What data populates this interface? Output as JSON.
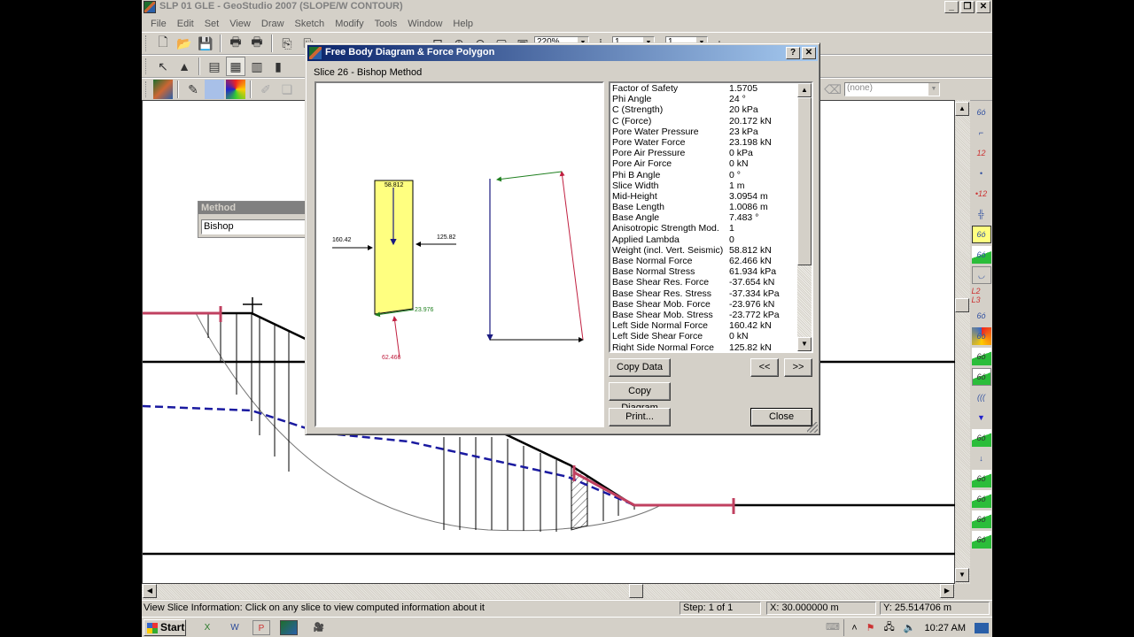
{
  "app": {
    "title": "SLP 01 GLE - GeoStudio 2007 (SLOPE/W CONTOUR)",
    "window_buttons": [
      "minimize",
      "restore",
      "close"
    ]
  },
  "menu": [
    "File",
    "Edit",
    "Set",
    "View",
    "Draw",
    "Sketch",
    "Modify",
    "Tools",
    "Window",
    "Help"
  ],
  "toolbar": {
    "zoom_value": "220%",
    "x_select": "1",
    "y_select": "1",
    "layer_select": "(none)"
  },
  "method_panel": {
    "title": "Method",
    "selected": "Bishop"
  },
  "dialog": {
    "title": "Free Body Diagram & Force Polygon",
    "help_button": "?",
    "close_button": "✕",
    "subtitle": "Slice 26 - Bishop Method",
    "diagram": {
      "weight_label": "58.812",
      "left_force_label": "160.42",
      "right_force_label": "125.82",
      "shear_label": "23.976",
      "normal_label": "62.466"
    },
    "properties": [
      {
        "name": "Factor of Safety",
        "value": "1.5705"
      },
      {
        "name": "Phi Angle",
        "value": "24 °"
      },
      {
        "name": "C (Strength)",
        "value": "20 kPa"
      },
      {
        "name": "C (Force)",
        "value": "20.172 kN"
      },
      {
        "name": "Pore Water Pressure",
        "value": "23 kPa"
      },
      {
        "name": "Pore Water Force",
        "value": "23.198 kN"
      },
      {
        "name": "Pore Air Pressure",
        "value": "0 kPa"
      },
      {
        "name": "Pore Air Force",
        "value": "0 kN"
      },
      {
        "name": "Phi B Angle",
        "value": "0 °"
      },
      {
        "name": "Slice Width",
        "value": "1 m"
      },
      {
        "name": "Mid-Height",
        "value": "3.0954 m"
      },
      {
        "name": "Base Length",
        "value": "1.0086 m"
      },
      {
        "name": "Base Angle",
        "value": "7.483 °"
      },
      {
        "name": "Anisotropic Strength Mod.",
        "value": "1"
      },
      {
        "name": "Applied Lambda",
        "value": "0"
      },
      {
        "name": "Weight (incl. Vert. Seismic)",
        "value": "58.812 kN"
      },
      {
        "name": "Base Normal Force",
        "value": "62.466 kN"
      },
      {
        "name": "Base Normal Stress",
        "value": "61.934 kPa"
      },
      {
        "name": "Base Shear Res. Force",
        "value": "-37.654 kN"
      },
      {
        "name": "Base Shear Res. Stress",
        "value": "-37.334 kPa"
      },
      {
        "name": "Base Shear Mob. Force",
        "value": "-23.976 kN"
      },
      {
        "name": "Base Shear Mob. Stress",
        "value": "-23.772 kPa"
      },
      {
        "name": "Left Side Normal Force",
        "value": "160.42 kN"
      },
      {
        "name": "Left Side Shear Force",
        "value": "0 kN"
      },
      {
        "name": "Right Side Normal Force",
        "value": "125.82 kN"
      }
    ],
    "buttons": {
      "copy_data": "Copy Data",
      "copy_diagram": "Copy Diagram",
      "print": "Print...",
      "prev": "<<",
      "next": ">>",
      "close": "Close"
    }
  },
  "status": {
    "message": "View Slice Information:  Click on any slice to view computed information about it",
    "step": "Step: 1 of 1",
    "x": "X: 30.000000 m",
    "y": "Y: 25.514706 m"
  },
  "taskbar": {
    "start": "Start",
    "clock": "10:27 AM"
  },
  "colors": {
    "dialog_title_start": "#0a246a",
    "dialog_title_end": "#a6caf0",
    "slice_fill": "#ffff80",
    "piezometric_line": "#1a1aa0",
    "slip_entry_exit": "#c04060",
    "normal_force": "#c02040",
    "shear_force": "#208020"
  }
}
